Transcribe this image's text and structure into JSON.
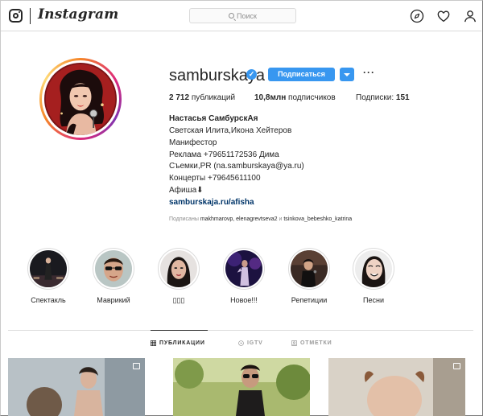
{
  "header": {
    "brand": "Instagram",
    "search_placeholder": "Поиск",
    "nav_icons": [
      "explore-icon",
      "heart-icon",
      "profile-icon"
    ]
  },
  "profile": {
    "username": "samburskaya",
    "verified": true,
    "follow_label": "Подписаться",
    "more_icon": "more-dots-icon",
    "stats": {
      "posts_count": "2 712",
      "posts_label": "публикаций",
      "followers_count": "10,8млн",
      "followers_label": "подписчиков",
      "following_label": "Подписки:",
      "following_count": "151"
    },
    "bio": {
      "name": "Настасья СамбурскАя",
      "lines": [
        "Светская Илита,Икона Хейтеров",
        "Манифестор",
        "Реклама +79651172536 Дима",
        "Съемки,PR (na.samburskaya@ya.ru)",
        "Концерты +79645611100",
        "Афиша⬇"
      ],
      "link": "samburskaja.ru/afisha"
    },
    "followed_by": {
      "prefix": "Подписаны",
      "users": "makhmarovp, elenagrevtseva2",
      "joiner": "и",
      "last_user": "tsinkova_bebeshko_katrina"
    }
  },
  "highlights": [
    {
      "label": "Спектакль"
    },
    {
      "label": "Маврикий"
    },
    {
      "label": "▯▯▯"
    },
    {
      "label": "Новое!!!"
    },
    {
      "label": "Репетиции"
    },
    {
      "label": "Песни"
    }
  ],
  "tabs": [
    {
      "label": "ПУБЛИКАЦИИ",
      "icon": "grid-icon",
      "active": true
    },
    {
      "label": "IGTV",
      "icon": "igtv-icon",
      "active": false
    },
    {
      "label": "ОТМЕТКИ",
      "icon": "tagged-icon",
      "active": false
    }
  ],
  "colors": {
    "accent": "#3897f0",
    "link": "#003569",
    "border": "#dbdbdb",
    "muted": "#8e8e8e",
    "text": "#262626"
  }
}
